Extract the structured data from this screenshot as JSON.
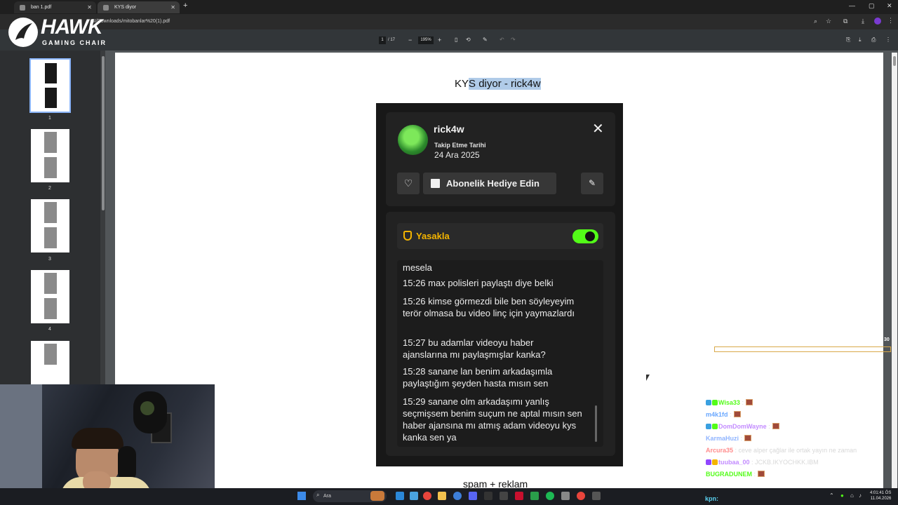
{
  "browser": {
    "tabs": [
      {
        "label": "ban 1.pdf"
      },
      {
        "label": "KYS diyor"
      }
    ],
    "url": "SI/Downloads/mitobanlar%20(1).pdf"
  },
  "pdf_toolbar": {
    "page_current": "1",
    "page_total": "/ 17",
    "zoom": "195%"
  },
  "thumbnails": [
    {
      "num": "1"
    },
    {
      "num": "2"
    },
    {
      "num": "3"
    },
    {
      "num": "4"
    }
  ],
  "document": {
    "title_plain": "KY",
    "title_highlight": "S diyor - rick4w",
    "next_heading": "spam + reklam"
  },
  "profile_card": {
    "username": "rick4w",
    "follow_label": "Takip Etme Tarihi",
    "follow_date": "24 Ara 2025",
    "gift_button": "Abonelik Hediye Edin",
    "ban_label": "Yasakla",
    "ban_enabled": true,
    "messages": [
      "mesela",
      "15:26 max polisleri paylaştı diye belki",
      "15:26 kimse görmezdi bile ben söyleyeyim terör olmasa bu video linç için yaymazlardı",
      "15:27 bu adamlar videoyu haber ajanslarına mı paylaşmışlar kanka?",
      "15:28 sanane lan benim arkadaşımla paylaştığım şeyden hasta mısın sen",
      "15:29 sanane olm arkadaşımı yanlış seçmişsem benim suçum ne aptal mısın sen haber ajansına mı atmış adam videoyu kys kanka sen ya"
    ]
  },
  "overlay": {
    "logo_text": "HAWK",
    "logo_sub": "GAMING CHAIR",
    "goal_count": "30",
    "chat": [
      {
        "user": "Wisa33",
        "color": "#53fc18",
        "text": ":"
      },
      {
        "user": "m4k1fd",
        "color": "#6aa8ff",
        "text": ":"
      },
      {
        "user": "DomDomWayne",
        "color": "#c38cff",
        "text": ":"
      },
      {
        "user": "KarmaHuzi",
        "color": "#8fb4ff",
        "text": ":"
      },
      {
        "user": "Arcura35",
        "color": "#ff8c8c",
        "text": ": ceve alper çağlar ile ortak yayın ne zaman"
      },
      {
        "user": "tuubaa_00",
        "color": "#c38cff",
        "text": ": JCKB.IKYOCHKK.IBM"
      },
      {
        "user": "BUGRADUNEM",
        "color": "#53fc18",
        "text": ":"
      }
    ],
    "kpn": "kpn:"
  },
  "taskbar": {
    "search_placeholder": "Ara",
    "time": "4:01:41 ÖS",
    "date": "11.04.2026"
  }
}
